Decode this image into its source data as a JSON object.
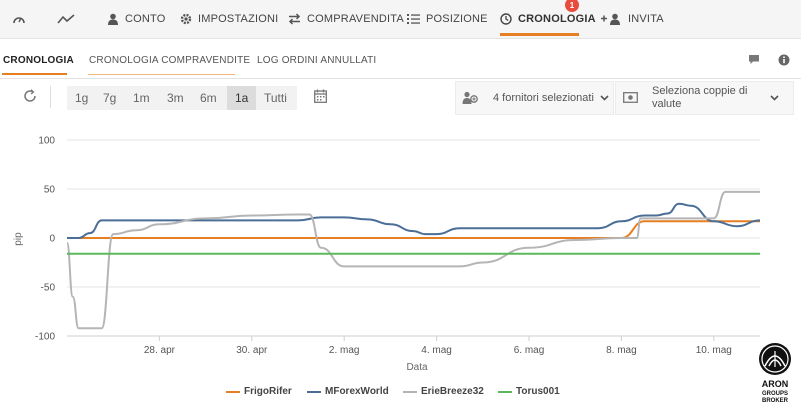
{
  "nav": {
    "items": [
      {
        "label": "",
        "icon": "speedometer-icon"
      },
      {
        "label": "",
        "icon": "trend-line-icon"
      },
      {
        "label": "CONTO",
        "icon": "user-icon"
      },
      {
        "label": "IMPOSTAZIONI",
        "icon": "gear-icon"
      },
      {
        "label": "COMPRAVENDITA",
        "icon": "transfer-arrows-icon"
      },
      {
        "label": "POSIZIONE",
        "icon": "list-icon"
      },
      {
        "label": "CRONOLOGIA",
        "icon": "clock-icon",
        "active": true,
        "badge": "1"
      },
      {
        "label": "INVITA",
        "icon": "add-user-icon"
      }
    ]
  },
  "subtabs": {
    "items": [
      "CRONOLOGIA",
      "CRONOLOGIA COMPRAVENDITE",
      "LOG ORDINI ANNULLATI"
    ],
    "active": "CRONOLOGIA"
  },
  "toolbar": {
    "ranges": [
      "1g",
      "7g",
      "1m",
      "3m",
      "6m",
      "1a",
      "Tutti"
    ],
    "active_range": "1a",
    "providers_label": "4 fornitori selezionati",
    "pairs_label_line1": "Seleziona coppie di",
    "pairs_label_line2": "valute"
  },
  "colors": {
    "accent": "#e67e22",
    "badge": "#e74c3c"
  },
  "chart_data": {
    "type": "line",
    "xlabel": "Data",
    "ylabel": "pip",
    "ylim": [
      -100,
      100
    ],
    "yticks": [
      100,
      50,
      0,
      -50,
      -100
    ],
    "x_domain": [
      "2024-04-26",
      "2024-05-11"
    ],
    "xticks": [
      "28. apr",
      "30. apr",
      "2. mag",
      "4. mag",
      "6. mag",
      "8. mag",
      "10. mag"
    ],
    "xtick_dates": [
      "2024-04-28",
      "2024-04-30",
      "2024-05-02",
      "2024-05-04",
      "2024-05-06",
      "2024-05-08",
      "2024-05-10"
    ],
    "series": [
      {
        "name": "FrigoRifer",
        "color": "#e67e22",
        "x": [
          "2024-04-26",
          "2024-05-08",
          "2024-05-08T12:00",
          "2024-05-11"
        ],
        "values": [
          0,
          0,
          17,
          17
        ]
      },
      {
        "name": "MForexWorld",
        "color": "#4a6e96",
        "x": [
          "2024-04-26",
          "2024-04-26T06:00",
          "2024-04-26T12:00",
          "2024-04-26T18:00",
          "2024-04-27",
          "2024-05-01",
          "2024-05-01T12:00",
          "2024-05-02",
          "2024-05-02T12:00",
          "2024-05-03",
          "2024-05-03T12:00",
          "2024-05-03T18:00",
          "2024-05-04",
          "2024-05-04T12:00",
          "2024-05-07",
          "2024-05-07T12:00",
          "2024-05-08",
          "2024-05-08T12:00",
          "2024-05-08T18:00",
          "2024-05-09",
          "2024-05-09T06:00",
          "2024-05-09T12:00",
          "2024-05-10",
          "2024-05-10T12:00",
          "2024-05-11"
        ],
        "values": [
          0,
          0,
          5,
          18,
          18,
          18,
          21,
          21,
          19,
          14,
          7,
          4,
          4,
          10,
          10,
          10,
          17,
          23,
          23,
          25,
          35,
          33,
          17,
          12,
          18
        ]
      },
      {
        "name": "ErieBreeze32",
        "color": "#b5b5b5",
        "x": [
          "2024-04-26",
          "2024-04-26T03:00",
          "2024-04-26T06:00",
          "2024-04-26T12:00",
          "2024-04-26T18:00",
          "2024-04-27",
          "2024-04-27T12:00",
          "2024-04-28",
          "2024-04-29",
          "2024-04-30",
          "2024-05-01",
          "2024-05-01T06:00",
          "2024-05-01T12:00",
          "2024-05-02",
          "2024-05-03",
          "2024-05-04",
          "2024-05-04T12:00",
          "2024-05-05",
          "2024-05-06",
          "2024-05-07",
          "2024-05-08",
          "2024-05-08T08:00",
          "2024-05-08T10:00",
          "2024-05-09",
          "2024-05-10",
          "2024-05-10T06:00",
          "2024-05-10T12:00",
          "2024-05-11"
        ],
        "values": [
          -5,
          -60,
          -92,
          -92,
          -92,
          4,
          8,
          14,
          20,
          23,
          24,
          24,
          -10,
          -29,
          -29,
          -29,
          -29,
          -25,
          -10,
          -2,
          0,
          0,
          20,
          20,
          20,
          47,
          47,
          47
        ]
      },
      {
        "name": "Torus001",
        "color": "#5cb85c",
        "x": [
          "2024-04-26",
          "2024-05-11"
        ],
        "values": [
          -16,
          -16
        ]
      }
    ]
  }
}
